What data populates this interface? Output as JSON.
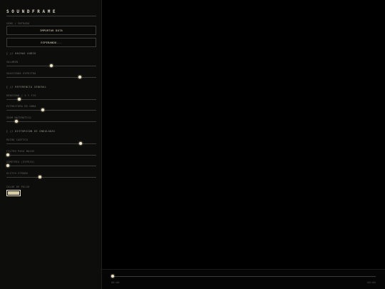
{
  "app": {
    "title": "SOUNDFRAME"
  },
  "sidebar": {
    "source_label": "SONG / ENTRADA",
    "import_button": "IMPORTAR DATA",
    "status_button": "ESPERANDO...",
    "sections": {
      "audio": "[ // HACHAS AUDIO",
      "visual": "[ // REFERENCIA GENERAL",
      "distortion": "[ // DISTORSIÓN DE ONDULADAS"
    },
    "sliders": [
      {
        "id": "volumen",
        "label": "VOLUMEN",
        "value": 0.5
      },
      {
        "id": "suavizado",
        "label": "SUAVIZADO ESPECTRO",
        "value": 0.83
      },
      {
        "id": "densidad",
        "label": "DENSIDAD / X Y FIS",
        "value": 0.13
      },
      {
        "id": "estructura",
        "label": "ESTRUCTURA DE ONDA",
        "value": 0.4
      },
      {
        "id": "zoom",
        "label": "ZOOM MATEMÁTICO",
        "value": 0.1
      },
      {
        "id": "ruido",
        "label": "RUIDO CAÓTICO",
        "value": 0.84
      },
      {
        "id": "filtro",
        "label": "FILTRO PASA BAJOS",
        "value": 0.0
      },
      {
        "id": "simetria",
        "label": "SIMETRÍA (ESPEJO)",
        "value": 0.0
      },
      {
        "id": "glitch",
        "label": "GLITCH STROBO",
        "value": 0.37
      }
    ],
    "color_label": "COLOR DE PULSO",
    "color_value": "#d6cba5"
  },
  "player": {
    "progress": 0.0,
    "time_current": "00:00",
    "time_total": "00:00"
  }
}
